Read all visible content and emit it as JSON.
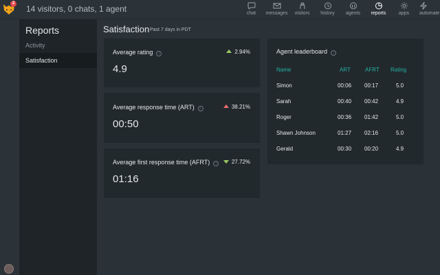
{
  "topbar": {
    "notification_count": "2",
    "status_text": "14 visitors, 0 chats, 1 agent",
    "nav": [
      {
        "label": "chat",
        "icon": "chat-bubble-icon"
      },
      {
        "label": "messages",
        "icon": "messages-icon"
      },
      {
        "label": "visitors",
        "icon": "visitors-icon"
      },
      {
        "label": "history",
        "icon": "history-icon"
      },
      {
        "label": "agents",
        "icon": "agents-icon"
      },
      {
        "label": "reports",
        "icon": "reports-icon",
        "active": true
      },
      {
        "label": "apps",
        "icon": "apps-gear-icon"
      },
      {
        "label": "automate",
        "icon": "automate-icon"
      }
    ]
  },
  "sidebar": {
    "title": "Reports",
    "items": [
      {
        "label": "Activity"
      },
      {
        "label": "Satisfaction",
        "active": true
      }
    ]
  },
  "main": {
    "title": "Satisfaction",
    "subtitle": "Past 7 days in PDT"
  },
  "metrics": [
    {
      "label": "Average rating",
      "delta": "2.94%",
      "direction": "up",
      "delta_color": "#9ccc65",
      "value": "4.9"
    },
    {
      "label": "Average response time (ART)",
      "delta": "38.21%",
      "direction": "up",
      "delta_color": "#ef6a6e",
      "value": "00:50"
    },
    {
      "label": "Average first response time (AFRT)",
      "delta": "27.72%",
      "direction": "down",
      "delta_color": "#9ccc65",
      "value": "01:16"
    }
  ],
  "leaderboard": {
    "title": "Agent leaderboard",
    "columns": [
      "Name",
      "ART",
      "AFRT",
      "Rating"
    ],
    "rows": [
      [
        "Simon",
        "00:06",
        "00:17",
        "5.0"
      ],
      [
        "Sarah",
        "00:40",
        "00:42",
        "4.9"
      ],
      [
        "Roger",
        "00:36",
        "01:42",
        "5.0"
      ],
      [
        "Shawn Johnson",
        "01:27",
        "02:16",
        "5.0"
      ],
      [
        "Gerald",
        "00:30",
        "00:20",
        "4.9"
      ]
    ]
  },
  "colors": {
    "accent_teal": "#25b0a2",
    "up_green": "#9ccc65",
    "up_red": "#ef6a6e",
    "background": "#2b3237",
    "card": "#22292d",
    "sidebar": "#1e2428"
  }
}
